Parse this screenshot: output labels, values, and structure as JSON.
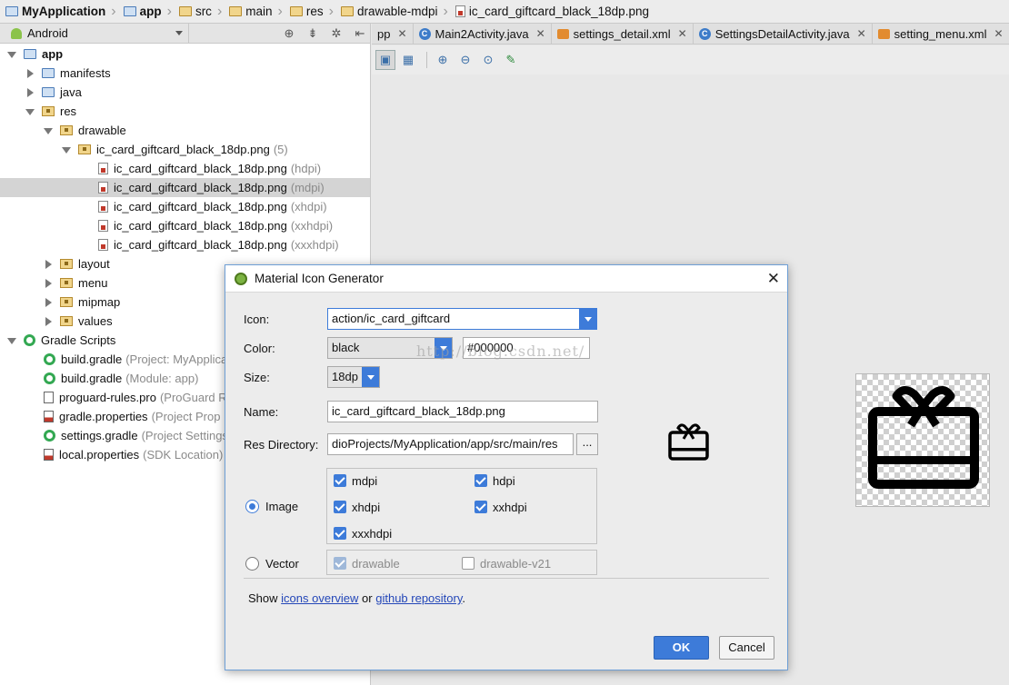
{
  "breadcrumb": [
    {
      "label": "MyApplication",
      "icon": "folder-icon"
    },
    {
      "label": "app",
      "icon": "folder-icon"
    },
    {
      "label": "src",
      "icon": "folder-icon"
    },
    {
      "label": "main",
      "icon": "folder-icon"
    },
    {
      "label": "res",
      "icon": "folder-icon"
    },
    {
      "label": "drawable-mdpi",
      "icon": "folder-icon"
    },
    {
      "label": "ic_card_giftcard_black_18dp.png",
      "icon": "png-file-icon"
    }
  ],
  "project_panel": {
    "view": "Android",
    "tree": [
      {
        "label": "app",
        "hint": ""
      },
      {
        "label": "manifests",
        "hint": ""
      },
      {
        "label": "java",
        "hint": ""
      },
      {
        "label": "res",
        "hint": ""
      },
      {
        "label": "drawable",
        "hint": ""
      },
      {
        "label": "ic_card_giftcard_black_18dp.png",
        "hint": "(5)"
      },
      {
        "label": "ic_card_giftcard_black_18dp.png",
        "hint": "(hdpi)"
      },
      {
        "label": "ic_card_giftcard_black_18dp.png",
        "hint": "(mdpi)"
      },
      {
        "label": "ic_card_giftcard_black_18dp.png",
        "hint": "(xhdpi)"
      },
      {
        "label": "ic_card_giftcard_black_18dp.png",
        "hint": "(xxhdpi)"
      },
      {
        "label": "ic_card_giftcard_black_18dp.png",
        "hint": "(xxxhdpi)"
      },
      {
        "label": "layout",
        "hint": ""
      },
      {
        "label": "menu",
        "hint": ""
      },
      {
        "label": "mipmap",
        "hint": ""
      },
      {
        "label": "values",
        "hint": ""
      },
      {
        "label": "Gradle Scripts",
        "hint": ""
      },
      {
        "label": "build.gradle",
        "hint": "(Project: MyApplica"
      },
      {
        "label": "build.gradle",
        "hint": "(Module: app)"
      },
      {
        "label": "proguard-rules.pro",
        "hint": "(ProGuard R"
      },
      {
        "label": "gradle.properties",
        "hint": "(Project Prop"
      },
      {
        "label": "settings.gradle",
        "hint": "(Project Settings"
      },
      {
        "label": "local.properties",
        "hint": "(SDK Location)"
      }
    ]
  },
  "editor_tabs": [
    {
      "label": "pp",
      "icon": "xml-file-icon"
    },
    {
      "label": "Main2Activity.java",
      "icon": "java-class-icon"
    },
    {
      "label": "settings_detail.xml",
      "icon": "xml-file-icon"
    },
    {
      "label": "SettingsDetailActivity.java",
      "icon": "java-class-icon"
    },
    {
      "label": "setting_menu.xml",
      "icon": "xml-file-icon"
    }
  ],
  "dialog": {
    "title": "Material Icon Generator",
    "icon_label": "Icon:",
    "icon_value": "action/ic_card_giftcard",
    "color_label": "Color:",
    "color_value": "black",
    "color_hex": "#000000",
    "size_label": "Size:",
    "size_value": "18dp",
    "name_label": "Name:",
    "name_value": "ic_card_giftcard_black_18dp.png",
    "resdir_label": "Res Directory:",
    "resdir_value": "dioProjects/MyApplication/app/src/main/res",
    "browse_label": "...",
    "image_label": "Image",
    "vector_label": "Vector",
    "densities": [
      "mdpi",
      "hdpi",
      "xhdpi",
      "xxhdpi",
      "xxxhdpi"
    ],
    "vector_options": [
      "drawable",
      "drawable-v21"
    ],
    "show_prefix": "Show",
    "link_icons": "icons overview",
    "show_or": "or",
    "link_github": "github repository",
    "show_suffix": ".",
    "ok_label": "OK",
    "cancel_label": "Cancel",
    "watermark": "http://blog.csdn.net/"
  },
  "colors": {
    "accent": "#3d7bd9",
    "link": "#2447b8"
  }
}
